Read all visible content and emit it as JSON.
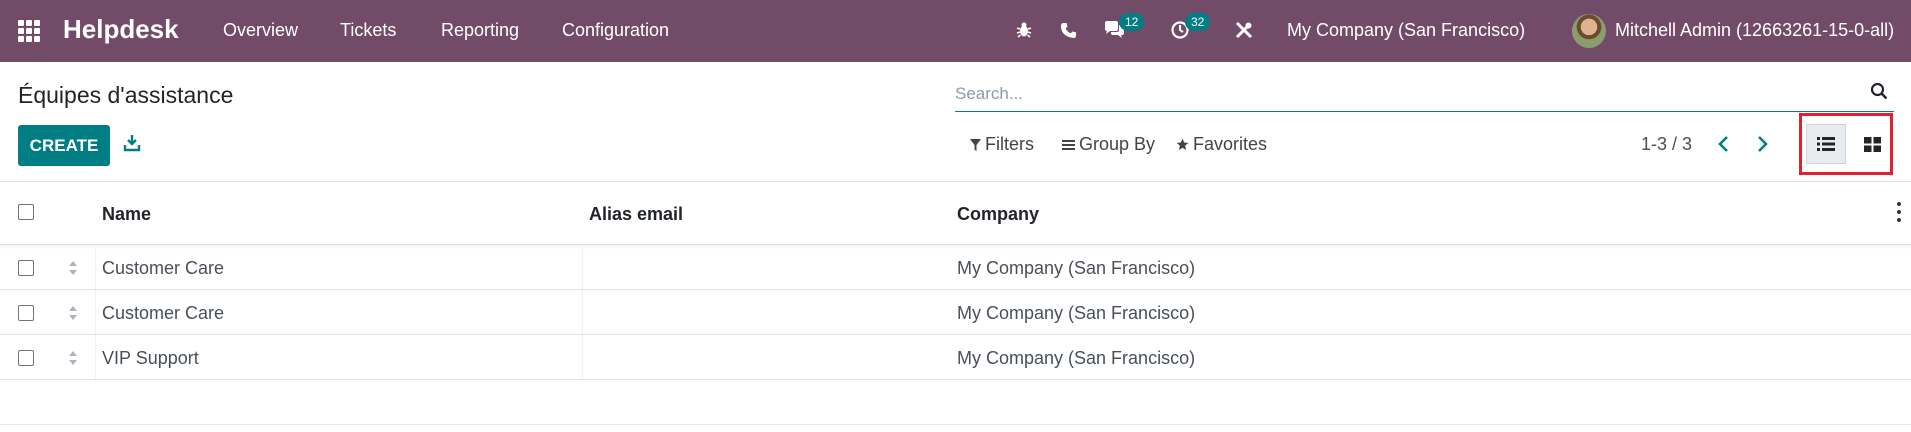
{
  "navbar": {
    "brand": "Helpdesk",
    "menu": [
      "Overview",
      "Tickets",
      "Reporting",
      "Configuration"
    ],
    "messages_badge": "12",
    "activities_badge": "32",
    "company": "My Company (San Francisco)",
    "user": "Mitchell Admin (12663261-15-0-all)",
    "colors": {
      "navbar": "#714B67",
      "accent": "#017e84",
      "highlight": "#e0202e"
    }
  },
  "control_panel": {
    "title": "Équipes d'assistance",
    "create_label": "CREATE",
    "search_placeholder": "Search...",
    "filters_label": "Filters",
    "group_by_label": "Group By",
    "favorites_label": "Favorites",
    "pager": "1-3 / 3",
    "views": [
      "list",
      "kanban"
    ],
    "active_view": "list"
  },
  "table": {
    "columns": [
      "Name",
      "Alias email",
      "Company"
    ],
    "rows": [
      {
        "name": "Customer Care",
        "alias_email": "",
        "company": "My Company (San Francisco)"
      },
      {
        "name": "Customer Care",
        "alias_email": "",
        "company": "My Company (San Francisco)"
      },
      {
        "name": "VIP Support",
        "alias_email": "",
        "company": "My Company (San Francisco)"
      }
    ]
  }
}
